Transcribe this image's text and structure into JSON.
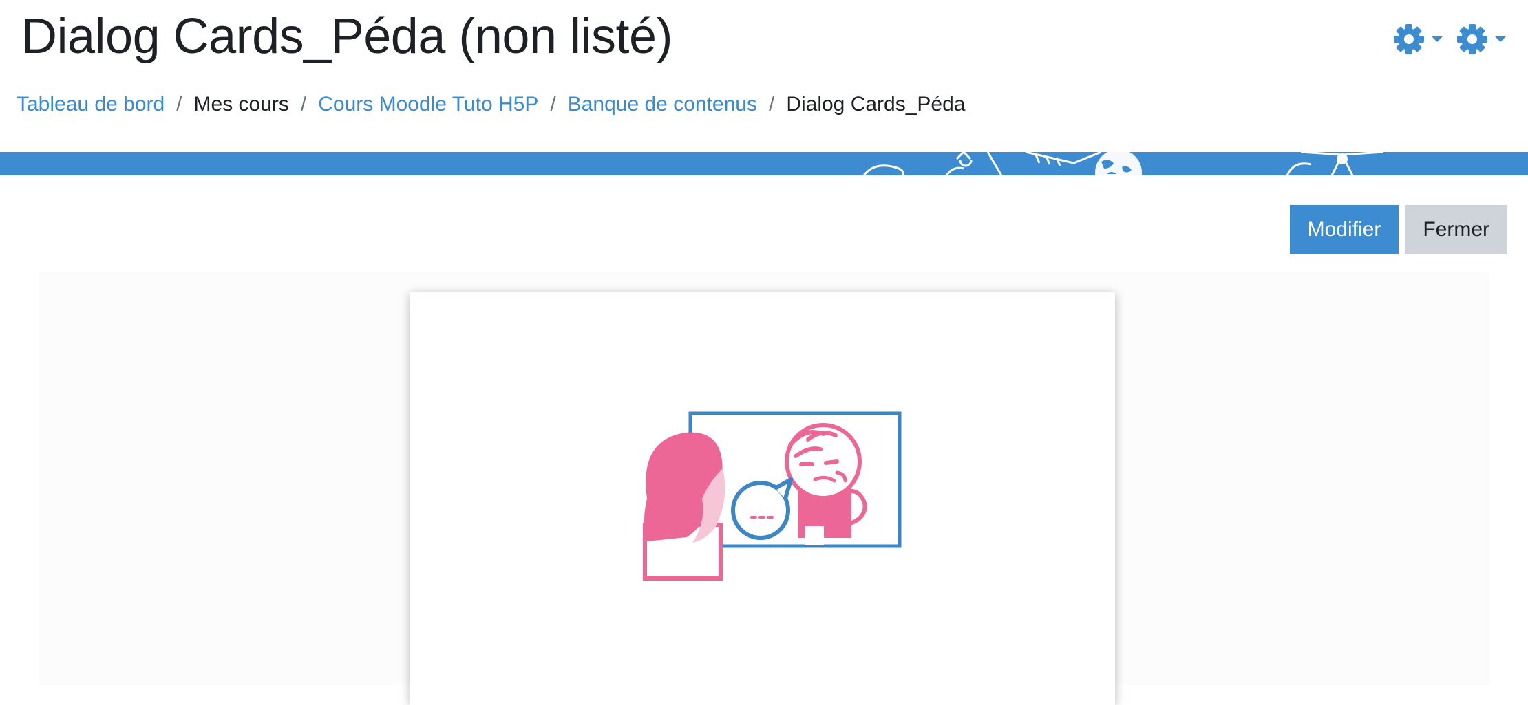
{
  "page": {
    "title": "Dialog Cards_Péda (non listé)"
  },
  "header_actions": [
    {
      "icon": "gear-icon",
      "caret": "caret-down-icon"
    },
    {
      "icon": "gear-icon",
      "caret": "caret-down-icon"
    }
  ],
  "breadcrumb": {
    "items": [
      {
        "label": "Tableau de bord",
        "link": true
      },
      {
        "label": "Mes cours",
        "link": false
      },
      {
        "label": "Cours Moodle Tuto H5P",
        "link": true
      },
      {
        "label": "Banque de contenus",
        "link": true
      },
      {
        "label": "Dialog Cards_Péda",
        "link": false
      }
    ],
    "separator": "/"
  },
  "actions": {
    "edit_label": "Modifier",
    "close_label": "Fermer"
  },
  "colors": {
    "accent": "#3d8bd1",
    "link": "#3a8ad0",
    "illustration_pink": "#ec6795",
    "illustration_blue": "#3d86c6",
    "secondary_button": "#ced4da"
  }
}
